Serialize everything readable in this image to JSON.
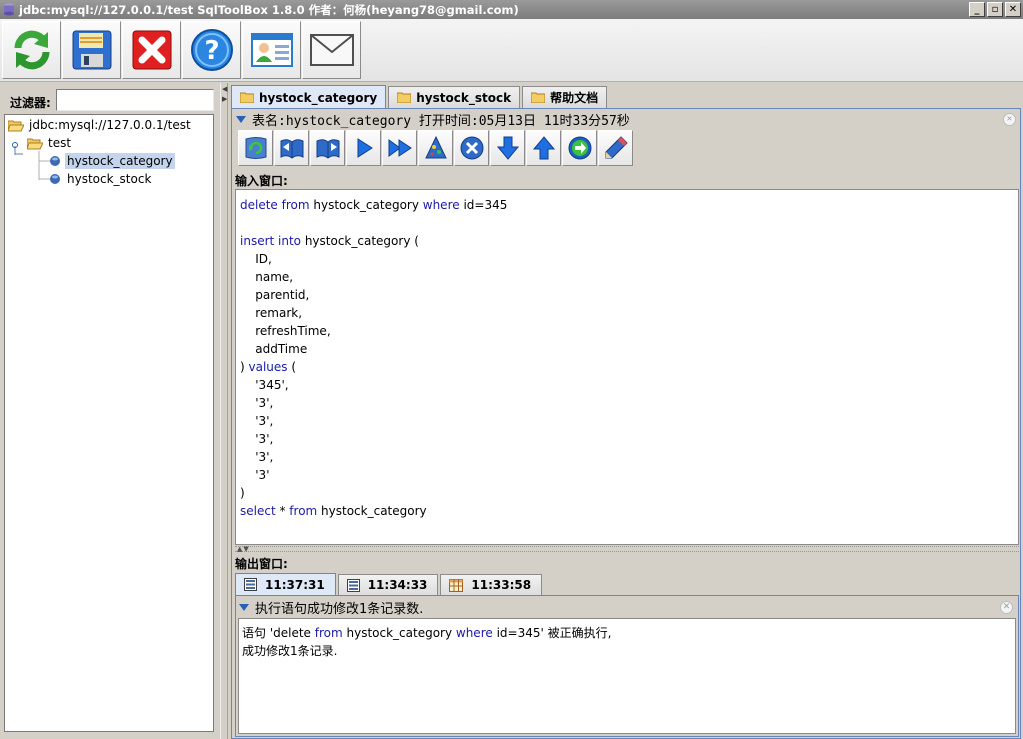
{
  "window": {
    "title": "jdbc:mysql://127.0.0.1/test SqlToolBox 1.8.0 作者：何杨(heyang78@gmail.com)",
    "controls": [
      "_",
      "▫",
      "✕"
    ]
  },
  "toolbar": {
    "buttons": [
      {
        "name": "refresh",
        "icon": "refresh-arrows-icon"
      },
      {
        "name": "save",
        "icon": "floppy-disk-icon"
      },
      {
        "name": "close",
        "icon": "red-x-icon"
      },
      {
        "name": "help",
        "icon": "question-mark-icon"
      },
      {
        "name": "contact",
        "icon": "contact-card-icon"
      },
      {
        "name": "email",
        "icon": "envelope-icon"
      }
    ]
  },
  "left": {
    "filter_label": "过滤器:",
    "filter_value": "",
    "tree": {
      "root": "jdbc:mysql://127.0.0.1/test",
      "schema": "test",
      "tables": [
        "hystock_category",
        "hystock_stock"
      ],
      "selected": "hystock_category"
    }
  },
  "tabs": [
    {
      "label": "hystock_category",
      "active": true
    },
    {
      "label": "hystock_stock",
      "active": false
    },
    {
      "label": "帮助文档",
      "active": false
    }
  ],
  "editor": {
    "header": "表名:hystock_category 打开时间:05月13日 11时33分57秒",
    "input_label": "输入窗口:",
    "sql_lines": [
      [
        {
          "k": true,
          "t": "delete from"
        },
        {
          "k": false,
          "t": " hystock_category "
        },
        {
          "k": true,
          "t": "where"
        },
        {
          "k": false,
          "t": " id=345"
        }
      ],
      [],
      [
        {
          "k": true,
          "t": "insert into"
        },
        {
          "k": false,
          "t": " hystock_category ("
        }
      ],
      [
        {
          "k": false,
          "t": "    ID,"
        }
      ],
      [
        {
          "k": false,
          "t": "    name,"
        }
      ],
      [
        {
          "k": false,
          "t": "    parentid,"
        }
      ],
      [
        {
          "k": false,
          "t": "    remark,"
        }
      ],
      [
        {
          "k": false,
          "t": "    refreshTime,"
        }
      ],
      [
        {
          "k": false,
          "t": "    addTime"
        }
      ],
      [
        {
          "k": false,
          "t": ") "
        },
        {
          "k": true,
          "t": "values"
        },
        {
          "k": false,
          "t": " ("
        }
      ],
      [
        {
          "k": false,
          "t": "    '345',"
        }
      ],
      [
        {
          "k": false,
          "t": "    '3',"
        }
      ],
      [
        {
          "k": false,
          "t": "    '3',"
        }
      ],
      [
        {
          "k": false,
          "t": "    '3',"
        }
      ],
      [
        {
          "k": false,
          "t": "    '3',"
        }
      ],
      [
        {
          "k": false,
          "t": "    '3'"
        }
      ],
      [
        {
          "k": false,
          "t": ")"
        }
      ],
      [
        {
          "k": true,
          "t": "select"
        },
        {
          "k": false,
          "t": " * "
        },
        {
          "k": true,
          "t": "from"
        },
        {
          "k": false,
          "t": " hystock_category"
        }
      ]
    ]
  },
  "output": {
    "label": "输出窗口:",
    "tabs": [
      {
        "label": "11:37:31",
        "icon": "grid-icon",
        "active": true
      },
      {
        "label": "11:34:33",
        "icon": "grid-icon",
        "active": false
      },
      {
        "label": "11:33:58",
        "icon": "table-icon",
        "active": false
      }
    ],
    "header": "执行语句成功修改1条记录数.",
    "lines": [
      [
        {
          "k": false,
          "t": "语句 'delete "
        },
        {
          "k": true,
          "t": "from"
        },
        {
          "k": false,
          "t": " hystock_category "
        },
        {
          "k": true,
          "t": "where"
        },
        {
          "k": false,
          "t": " id=345' 被正确执行,"
        }
      ],
      [
        {
          "k": false,
          "t": "成功修改1条记录."
        }
      ]
    ]
  }
}
